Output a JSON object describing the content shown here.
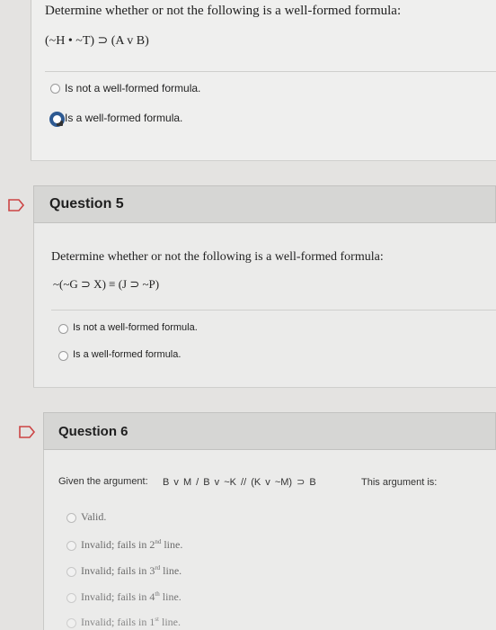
{
  "q4": {
    "prompt": "Determine whether or not the following is a well-formed formula:",
    "formula": "(~H • ~T) ⊃ (A v B)",
    "options": [
      {
        "label": "Is not a well-formed formula.",
        "selected": false
      },
      {
        "label": "Is a well-formed formula.",
        "selected": true
      }
    ]
  },
  "q5": {
    "title": "Question 5",
    "prompt": "Determine whether or not the following is a well-formed formula:",
    "formula": "~(~G ⊃ X) ≡ (J ⊃ ~P)",
    "options": [
      {
        "label": "Is not a well-formed formula."
      },
      {
        "label": "Is a well-formed formula."
      }
    ]
  },
  "q6": {
    "title": "Question 6",
    "given": "Given the argument:",
    "argument": "B v M  /  B v ~K  //  (K v ~M) ⊃ B",
    "suffix": "This argument is:",
    "options": [
      {
        "main": "Valid."
      },
      {
        "main": "Invalid; fails in 2",
        "sup": "nd",
        "tail": " line."
      },
      {
        "main": "Invalid; fails in 3",
        "sup": "rd",
        "tail": " line."
      },
      {
        "main": "Invalid; fails in 4",
        "sup": "th",
        "tail": " line."
      },
      {
        "main": "Invalid; fails in 1",
        "sup": "st",
        "tail": " line."
      }
    ]
  },
  "colors": {
    "selected_radio": "#2e5a92",
    "flag_stroke": "#c44"
  }
}
